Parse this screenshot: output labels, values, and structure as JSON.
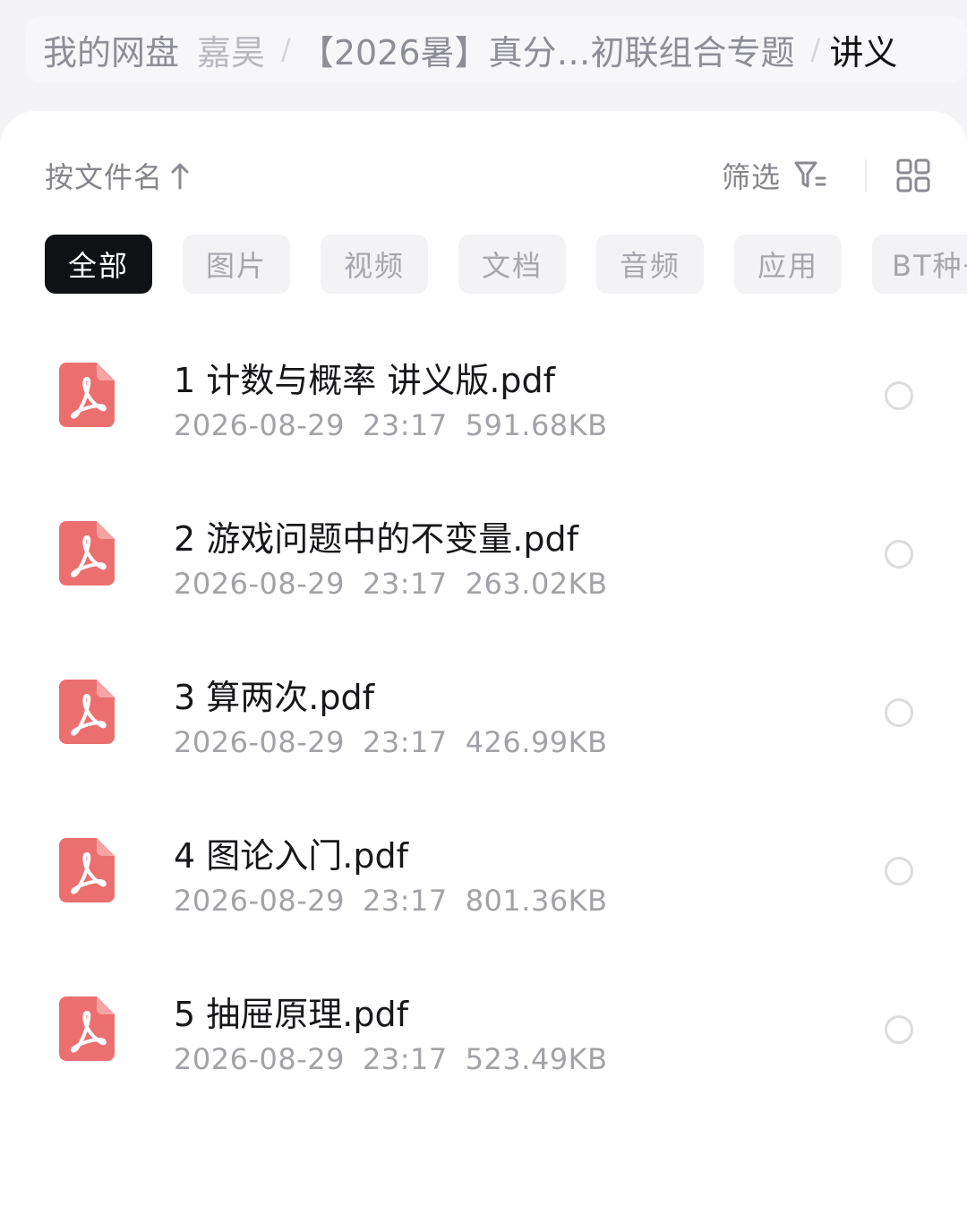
{
  "breadcrumb": {
    "items": [
      "我的网盘",
      "嘉昊",
      "【2026暑】真分…初联组合专题",
      "讲义"
    ],
    "separator": "/"
  },
  "toolbar": {
    "sort_label": "按文件名",
    "sort_icon": "arrow-up-icon",
    "filter_label": "筛选",
    "filter_icon": "filter-icon",
    "view_icon": "grid-view-icon"
  },
  "tabs": [
    "全部",
    "图片",
    "视频",
    "文档",
    "音频",
    "应用",
    "BT种子"
  ],
  "active_tab": "全部",
  "files": [
    {
      "name": "1 计数与概率 讲义版.pdf",
      "date": "2026-08-29",
      "time": "23:17",
      "size": "591.68KB"
    },
    {
      "name": "2 游戏问题中的不变量.pdf",
      "date": "2026-08-29",
      "time": "23:17",
      "size": "263.02KB"
    },
    {
      "name": "3 算两次.pdf",
      "date": "2026-08-29",
      "time": "23:17",
      "size": "426.99KB"
    },
    {
      "name": "4 图论入门.pdf",
      "date": "2026-08-29",
      "time": "23:17",
      "size": "801.36KB"
    },
    {
      "name": "5 抽屉原理.pdf",
      "date": "2026-08-29",
      "time": "23:17",
      "size": "523.49KB"
    }
  ],
  "colors": {
    "pdf_icon": "#ec6f6f",
    "active_tab_bg": "#101114",
    "text_primary": "#17171a",
    "text_secondary": "#a2a2a8"
  }
}
